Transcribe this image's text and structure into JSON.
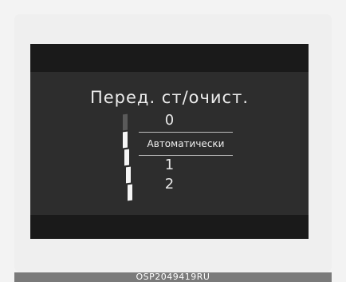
{
  "cluster": {
    "menu_title": "Перед. ст/очист.",
    "options": [
      "0",
      "Автоматически",
      "1",
      "2"
    ],
    "selected_option": "Автоматически",
    "wiper_level": {
      "segments_total": 5,
      "segments_lit": 4
    },
    "colors": {
      "screen_bg": "#2d2d2d",
      "bar_bg": "#1a1a1a",
      "text": "#ececec",
      "lit_segment": "#f5f5f5",
      "unlit_segment": "#5a5a5a"
    }
  },
  "caption": {
    "code": "OSP2049419RU"
  }
}
